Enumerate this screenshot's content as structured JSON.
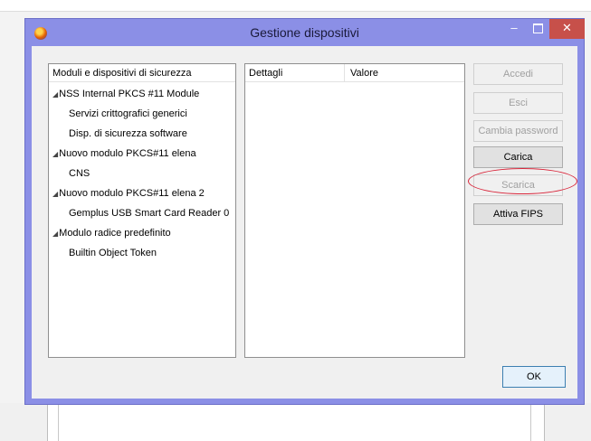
{
  "window": {
    "title": "Gestione dispositivi",
    "close_glyph": "✕",
    "min_glyph": "–",
    "title_bar_color": "#8b8fe6",
    "close_color": "#c7504a"
  },
  "tree": {
    "header": "Moduli e dispositivi di sicurezza",
    "expand_glyph": "◢",
    "items": [
      {
        "label": "NSS Internal PKCS #11 Module"
      },
      {
        "label": "Servizi crittografici generici"
      },
      {
        "label": "Disp. di sicurezza software"
      },
      {
        "label": "Nuovo modulo PKCS#11 elena"
      },
      {
        "label": "CNS"
      },
      {
        "label": "Nuovo modulo PKCS#11 elena 2"
      },
      {
        "label": "Gemplus USB Smart Card Reader 0"
      },
      {
        "label": "Modulo radice predefinito"
      },
      {
        "label": "Builtin Object Token"
      }
    ]
  },
  "details": {
    "col1": "Dettagli",
    "col2": "Valore"
  },
  "buttons": {
    "accedi": {
      "label": "Accedi",
      "enabled": false
    },
    "esci": {
      "label": "Esci",
      "enabled": false
    },
    "cambia_password": {
      "label": "Cambia password",
      "enabled": false
    },
    "carica": {
      "label": "Carica",
      "enabled": true
    },
    "scarica": {
      "label": "Scarica",
      "enabled": false
    },
    "attiva_fips": {
      "label": "Attiva FIPS",
      "enabled": true
    },
    "ok": {
      "label": "OK",
      "enabled": true
    }
  },
  "highlight_color": "#d9263b"
}
